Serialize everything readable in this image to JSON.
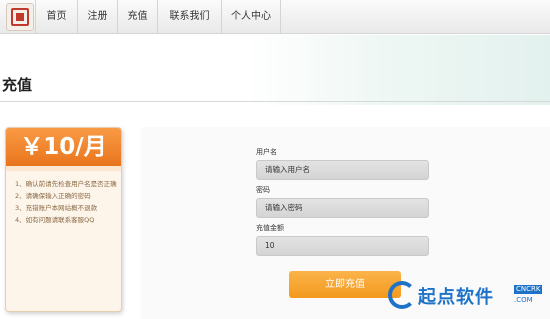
{
  "nav": {
    "items": [
      {
        "label": "首页"
      },
      {
        "label": "注册"
      },
      {
        "label": "充值"
      },
      {
        "label": "联系我们"
      },
      {
        "label": "个人中心"
      }
    ]
  },
  "page": {
    "title": "充值"
  },
  "price_card": {
    "price": "￥10/月",
    "tips": [
      "1、确认前请先检查用户名是否正确",
      "2、请确保输入正确的密码",
      "3、充错账户本网站概不退款",
      "4、如有问题请联系客服QQ"
    ]
  },
  "form": {
    "username_label": "用户名",
    "username_placeholder": "请输入用户名",
    "password_label": "密码",
    "password_placeholder": "请输入密码",
    "amount_label": "充值金额",
    "amount_value": "10",
    "submit_label": "立即充值"
  },
  "watermark": {
    "text": "起点软件",
    "tag": "CNCRK",
    "domain": ".COM"
  }
}
